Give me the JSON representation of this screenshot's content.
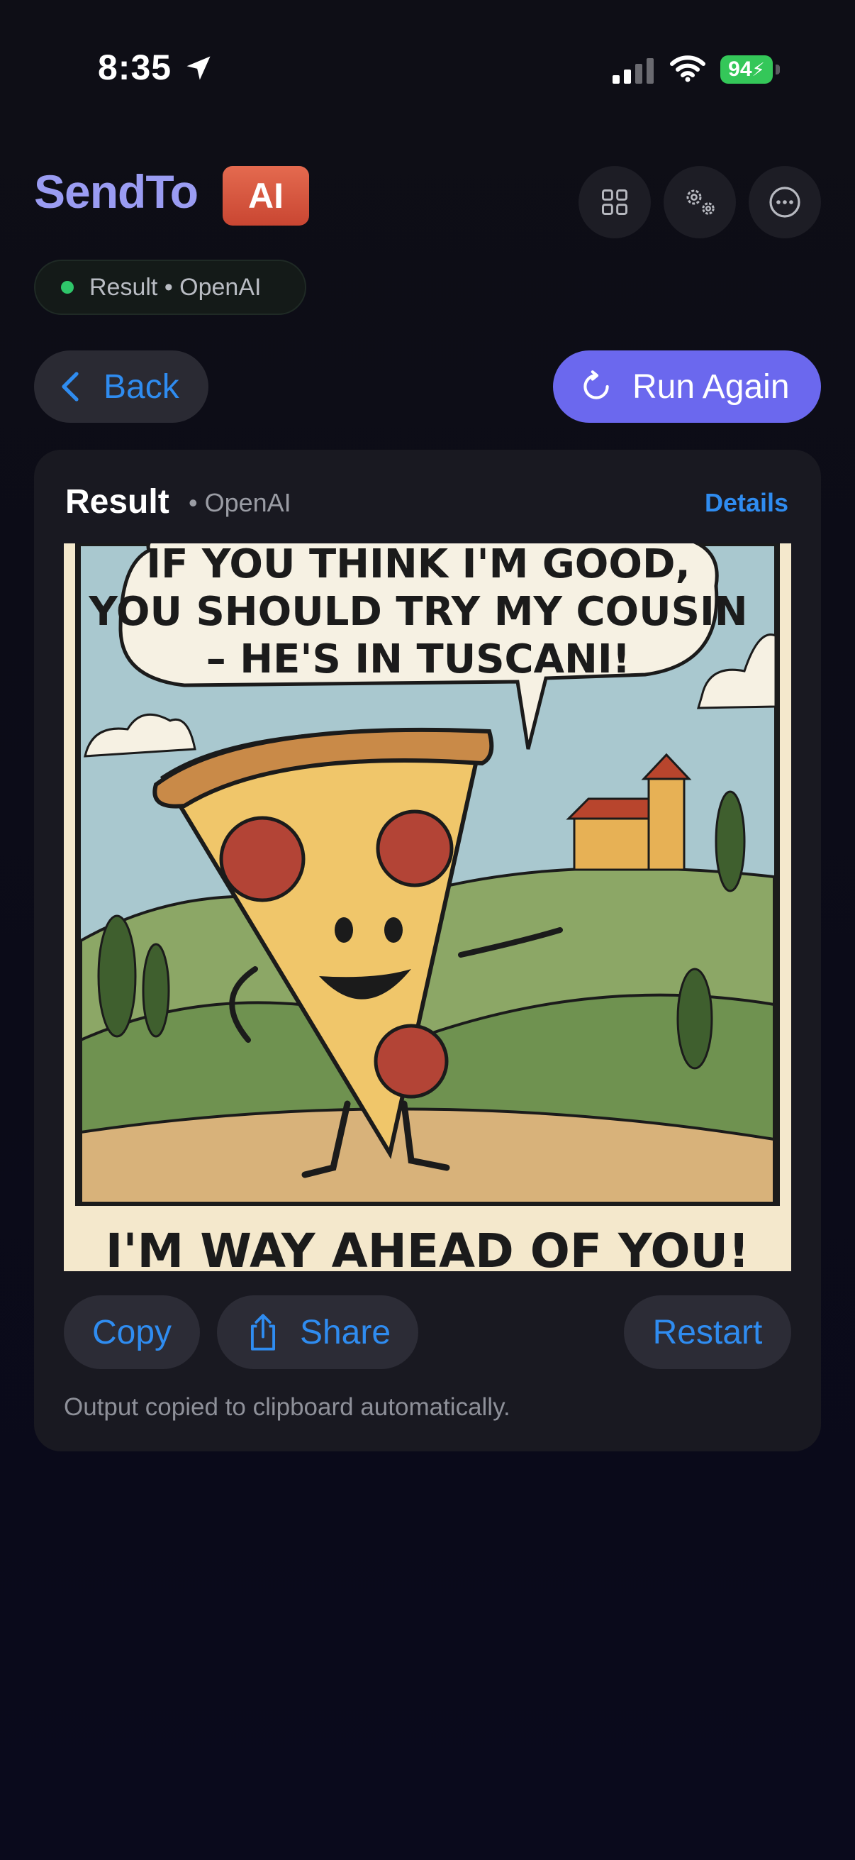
{
  "status_bar": {
    "time": "8:35",
    "battery": "94",
    "icons": [
      "location-arrow-icon",
      "signal-icon",
      "wifi-icon",
      "battery-charging-icon"
    ]
  },
  "header": {
    "brand": "SendTo",
    "badge": "AI",
    "icons": [
      "grid-icon",
      "gears-icon",
      "more-icon"
    ]
  },
  "status_pill": {
    "text": "Result • OpenAI",
    "dot_color": "#2fc66a"
  },
  "actions": {
    "back_label": "Back",
    "run_label": "Run Again"
  },
  "card": {
    "title": "Result",
    "subtitle": "• OpenAI",
    "details_label": "Details",
    "comic": {
      "speech_lines": [
        "IF YOU THINK I'M GOOD,",
        "YOU SHOULD TRY MY COUSIN",
        "– HE'S IN TUSCANI!"
      ],
      "caption": "I'M WAY AHEAD OF YOU!"
    },
    "buttons": {
      "copy": "Copy",
      "share": "Share",
      "restart": "Restart"
    },
    "note": "Output copied to clipboard automatically."
  },
  "colors": {
    "accent": "#2f8cf0",
    "run_button": "#6b68ee",
    "brand": "#9a9cf2",
    "ai_badge": "#d9553d"
  }
}
